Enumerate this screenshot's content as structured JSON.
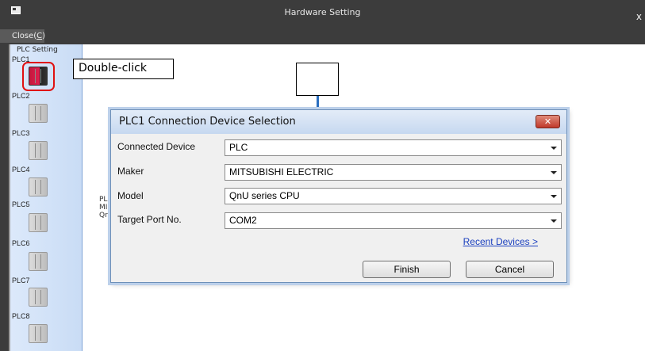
{
  "window": {
    "title": "Hardware Setting",
    "close_glyph": "x"
  },
  "menu": {
    "close_label": "Close(",
    "close_key": "C",
    "close_suffix": ")"
  },
  "sidebar": {
    "header": "PLC Setting",
    "items": [
      {
        "label": "PLC1",
        "active": true
      },
      {
        "label": "PLC2",
        "active": false
      },
      {
        "label": "PLC3",
        "active": false
      },
      {
        "label": "PLC4",
        "active": false
      },
      {
        "label": "PLC5",
        "active": false
      },
      {
        "label": "PLC6",
        "active": false
      },
      {
        "label": "PLC7",
        "active": false
      },
      {
        "label": "PLC8",
        "active": false
      }
    ]
  },
  "callout": {
    "text": "Double-click"
  },
  "background_text": [
    "PL",
    "MI",
    "Qr"
  ],
  "dialog": {
    "title": "PLC1 Connection Device Selection",
    "close_glyph": "✕",
    "fields": [
      {
        "label": "Connected Device",
        "value": "PLC"
      },
      {
        "label": "Maker",
        "value": "MITSUBISHI ELECTRIC"
      },
      {
        "label": "Model",
        "value": "QnU series CPU"
      },
      {
        "label": "Target Port No.",
        "value": "COM2"
      }
    ],
    "recent_link": "Recent Devices >",
    "finish_label": "Finish",
    "cancel_label": "Cancel"
  },
  "colors": {
    "titlebar": "#3c3c3c",
    "sidebar": "#c9dcf5",
    "highlight": "#e01010",
    "link": "#1a3fbf"
  }
}
